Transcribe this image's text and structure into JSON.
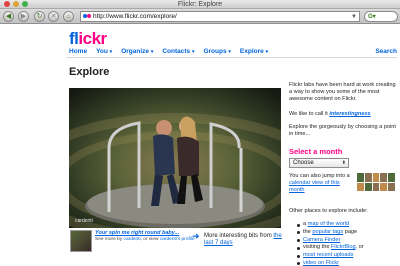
{
  "browser": {
    "window_title": "Flickr: Explore",
    "url": "http://www.flickr.com/explore/"
  },
  "header": {
    "logo_fl": "fl",
    "logo_ickr": "ickr",
    "nav": [
      "Home",
      "You",
      "Organize",
      "Contacts",
      "Groups",
      "Explore"
    ],
    "search_label": "Search"
  },
  "main": {
    "title": "Explore",
    "photo_credit": "cardenti",
    "caption_title": "Your spin me right round baby...",
    "caption_by_prefix": "See more by",
    "caption_by_user": "cardenti",
    "caption_by_view": ", or view",
    "caption_profile": "cardenti's profile",
    "more_prefix": "More interesting bits from",
    "more_link": "the last 7 days"
  },
  "side": {
    "intro": "Flickr labs have been hard at work creating a way to show you some of the most awesome content on Flickr.",
    "call_prefix": "We like to call it",
    "call_link": "interestingness",
    "explore_text": "Explore the gorgeously by choosing a point in time...",
    "select_heading": "Select a month",
    "select_value": "Choose",
    "calendar_prefix": "You can also jump into a",
    "calendar_link": "calendar view of this month",
    "places_heading": "Other places to explore include:",
    "places": [
      {
        "pre": "a",
        "link": "map of the world",
        "post": ""
      },
      {
        "pre": "the",
        "link": "popular tags",
        "post": "page"
      },
      {
        "pre": "",
        "link": "Camera Finder",
        "post": ""
      },
      {
        "pre": "visiting the",
        "link": "FlickrBlog",
        "post": ", or"
      },
      {
        "pre": "",
        "link": "most recent uploads",
        "post": ""
      },
      {
        "pre": "",
        "link": "video on Flickr",
        "post": ""
      }
    ]
  }
}
